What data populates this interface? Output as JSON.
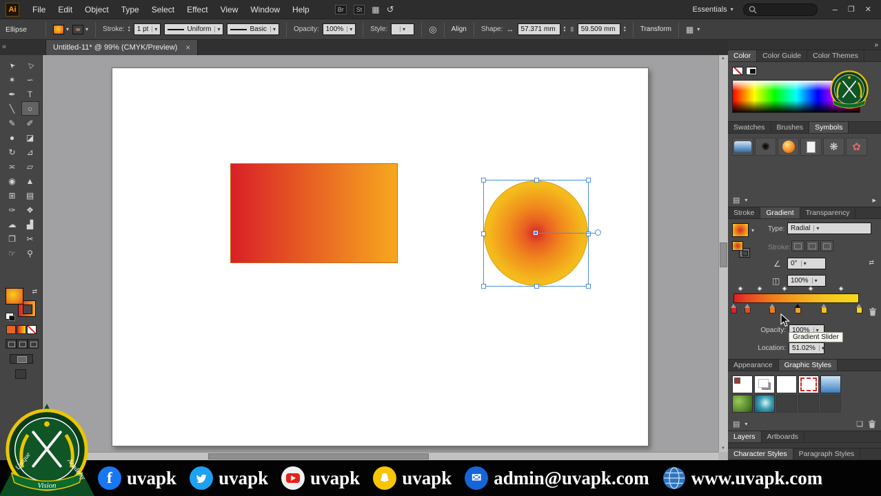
{
  "menubar": {
    "logo": "Ai",
    "items": [
      "File",
      "Edit",
      "Object",
      "Type",
      "Select",
      "Effect",
      "View",
      "Window",
      "Help"
    ],
    "br_badge": "Br",
    "st_badge": "St",
    "workspace": "Essentials"
  },
  "controlbar": {
    "tool_label": "Ellipse",
    "stroke_label": "Stroke:",
    "stroke_weight": "1 pt",
    "width_profile": "Uniform",
    "brush": "Basic",
    "opacity_label": "Opacity:",
    "opacity_value": "100%",
    "style_label": "Style:",
    "align_label": "Align",
    "shape_label": "Shape:",
    "width_value": "57.371 mm",
    "height_value": "59.509 mm",
    "transform_label": "Transform"
  },
  "tabbar": {
    "doc_title": "Untitled-11* @ 99% (CMYK/Preview)"
  },
  "tools": [
    {
      "name": "selection",
      "glyph": "➤"
    },
    {
      "name": "direct-selection",
      "glyph": "▷"
    },
    {
      "name": "magic-wand",
      "glyph": "✶"
    },
    {
      "name": "lasso",
      "glyph": "∽"
    },
    {
      "name": "pen",
      "glyph": "✒"
    },
    {
      "name": "type",
      "glyph": "T"
    },
    {
      "name": "line-segment",
      "glyph": "╲"
    },
    {
      "name": "ellipse",
      "glyph": "○"
    },
    {
      "name": "paintbrush",
      "glyph": "✎"
    },
    {
      "name": "pencil",
      "glyph": "✐"
    },
    {
      "name": "blob-brush",
      "glyph": "●"
    },
    {
      "name": "eraser",
      "glyph": "◪"
    },
    {
      "name": "rotate",
      "glyph": "↻"
    },
    {
      "name": "scale",
      "glyph": "⊿"
    },
    {
      "name": "width",
      "glyph": "≍"
    },
    {
      "name": "free-transform",
      "glyph": "▱"
    },
    {
      "name": "shape-builder",
      "glyph": "◉"
    },
    {
      "name": "perspective-grid",
      "glyph": "▲"
    },
    {
      "name": "mesh",
      "glyph": "⊞"
    },
    {
      "name": "gradient",
      "glyph": "▤"
    },
    {
      "name": "eyedropper",
      "glyph": "✑"
    },
    {
      "name": "blend",
      "glyph": "❖"
    },
    {
      "name": "symbol-sprayer",
      "glyph": "☁"
    },
    {
      "name": "column-graph",
      "glyph": "▟"
    },
    {
      "name": "artboard",
      "glyph": "❐"
    },
    {
      "name": "slice",
      "glyph": "✂"
    },
    {
      "name": "hand",
      "glyph": "☞"
    },
    {
      "name": "zoom",
      "glyph": "⚲"
    }
  ],
  "canvas": {
    "rect_gradient_from": "#d92027",
    "rect_gradient_to": "#f6a81f",
    "circle_center_color": "#ce2a28",
    "circle_edge_color": "#f6d71e",
    "selection_color": "#4a8fd5"
  },
  "panels": {
    "color_tabs": [
      "Color",
      "Color Guide",
      "Color Themes"
    ],
    "media_tabs": [
      "Swatches",
      "Brushes",
      "Symbols"
    ],
    "symbols": [
      "blue-flag",
      "ink-splat",
      "orange-sphere",
      "paper-sheet",
      "gray-pinwheel",
      "red-flower"
    ],
    "gradient_tabs": [
      "Stroke",
      "Gradient",
      "Transparency"
    ],
    "gradient": {
      "type_label": "Type:",
      "type_value": "Radial",
      "stroke_label": "Stroke:",
      "angle_value": "0°",
      "aspect_value": "100%",
      "opacity_label": "Opacity:",
      "opacity_value": "100%",
      "location_label": "Location:",
      "location_value": "51.02%",
      "tooltip": "Gradient Slider",
      "stops": [
        {
          "pos": "0%",
          "color": "#e01f23"
        },
        {
          "pos": "11%",
          "color": "#e8481f"
        },
        {
          "pos": "31%",
          "color": "#ef7d1c"
        },
        {
          "pos": "51%",
          "color": "#f3a31c"
        },
        {
          "pos": "72%",
          "color": "#f5c31d"
        },
        {
          "pos": "100%",
          "color": "#f6d81e"
        }
      ]
    },
    "style_tabs": [
      "Appearance",
      "Graphic Styles"
    ],
    "layer_tabs": [
      "Layers",
      "Artboards"
    ],
    "type_style_tabs": [
      "Character Styles",
      "Paragraph Styles"
    ]
  },
  "footer": {
    "items": [
      {
        "icon": "facebook",
        "label": "uvapk"
      },
      {
        "icon": "twitter",
        "label": "uvapk"
      },
      {
        "icon": "youtube",
        "label": "uvapk"
      },
      {
        "icon": "snapchat",
        "label": "uvapk"
      },
      {
        "icon": "email",
        "label": "admin@uvapk.com"
      },
      {
        "icon": "globe",
        "label": "www.uvapk.com"
      }
    ]
  },
  "logo": {
    "words": [
      "Unique",
      "Vision",
      "Academy"
    ]
  }
}
